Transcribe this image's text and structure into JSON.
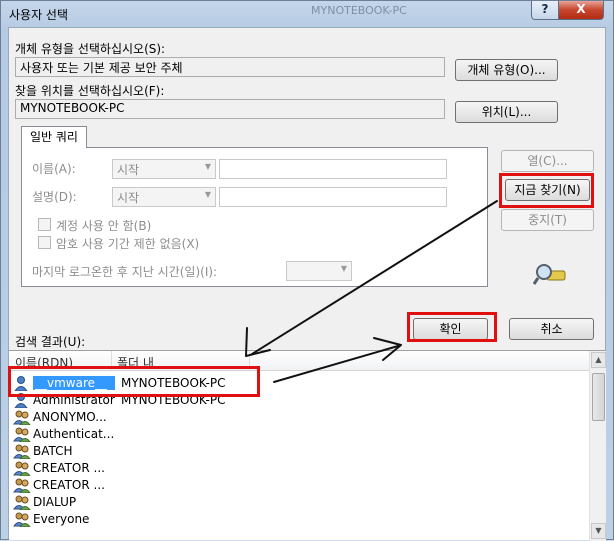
{
  "window": {
    "title": "사용자 선택",
    "ghost_title": "MYNOTEBOOK-PC",
    "help_label": "?",
    "close_label": "X"
  },
  "object_type": {
    "label": "개체 유형을 선택하십시오(S):",
    "value": "사용자 또는 기본 제공 보안 주체",
    "button": "개체 유형(O)..."
  },
  "location": {
    "label": "찾을 위치를 선택하십시오(F):",
    "value": "MYNOTEBOOK-PC",
    "button": "위치(L)..."
  },
  "tab": {
    "label": "일반 쿼리"
  },
  "query": {
    "name_label": "이름(A):",
    "name_combo": "시작",
    "desc_label": "설명(D):",
    "desc_combo": "시작",
    "disabled_accounts": "계정 사용 안 함(B)",
    "no_expire_password": "암호 사용 기간 제한 없음(X)",
    "days_since_logon": "마지막 로그온한 후 지난 시간(일)(I):"
  },
  "side_buttons": {
    "columns": "열(C)...",
    "find_now": "지금 찾기(N)",
    "stop": "중지(T)"
  },
  "actions": {
    "ok": "확인",
    "cancel": "취소"
  },
  "results": {
    "label": "검색 결과(U):",
    "columns": [
      "이름(RDN)",
      "폴더 내"
    ],
    "rows": [
      {
        "name": "__vmware__",
        "folder": "MYNOTEBOOK-PC",
        "icon": "user-icon",
        "selected": true
      },
      {
        "name": "Administrator",
        "folder": "MYNOTEBOOK-PC",
        "icon": "user-icon"
      },
      {
        "name": "ANONYMO...",
        "folder": "",
        "icon": "group-icon"
      },
      {
        "name": "Authenticat...",
        "folder": "",
        "icon": "group-icon"
      },
      {
        "name": "BATCH",
        "folder": "",
        "icon": "group-icon"
      },
      {
        "name": "CREATOR ...",
        "folder": "",
        "icon": "group-icon"
      },
      {
        "name": "CREATOR ...",
        "folder": "",
        "icon": "group-icon"
      },
      {
        "name": "DIALUP",
        "folder": "",
        "icon": "group-icon"
      },
      {
        "name": "Everyone",
        "folder": "",
        "icon": "group-icon"
      }
    ]
  },
  "colors": {
    "highlight": "#e01010",
    "selection": "#3399ff"
  }
}
